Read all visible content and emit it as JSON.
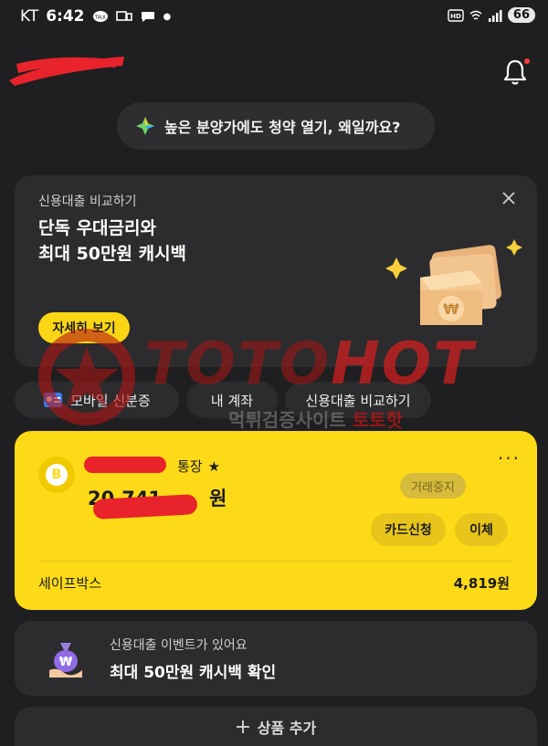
{
  "status_bar": {
    "carrier": "KT",
    "time": "6:42",
    "battery": "66"
  },
  "notice": {
    "text": "높은 분양가에도 청약 열기, 왜일까요?"
  },
  "promo": {
    "subtitle": "신용대출 비교하기",
    "title_line1": "단독 우대금리와",
    "title_line2": "최대 50만원 캐시백",
    "button": "자세히 보기",
    "art_symbol": "₩"
  },
  "quick_links": [
    {
      "label": "모바일 신분증",
      "icon": "id-card-icon"
    },
    {
      "label": "내 계좌"
    },
    {
      "label": "신용대출 비교하기"
    }
  ],
  "watermark": {
    "brand_part1": "TOTO",
    "brand_part2": "HOT",
    "sub_part1": "먹튀검증사이트",
    "sub_part2": "토토핫"
  },
  "account": {
    "avatar_letter": "B",
    "name_suffix": "통장",
    "star": "★",
    "balance_visible_prefix": "20,741,",
    "balance_visible_suffix": "원",
    "status_badge": "거래중지",
    "more": "···",
    "card_button": "카드신청",
    "transfer_button": "이체",
    "safebox_label": "세이프박스",
    "safebox_value": "4,819원"
  },
  "event": {
    "subtitle": "신용대출 이벤트가 있어요",
    "title": "최대 50만원 캐시백 확인"
  },
  "add_product": {
    "label": "상품 추가"
  }
}
